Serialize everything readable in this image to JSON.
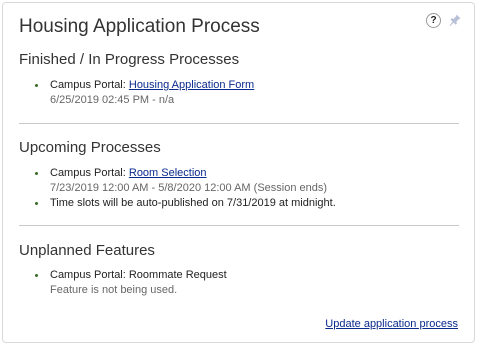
{
  "card": {
    "title": "Housing Application Process",
    "help_label": "?",
    "update_link": "Update application process"
  },
  "finished": {
    "heading": "Finished / In Progress Processes",
    "items": [
      {
        "prefix": "Campus Portal: ",
        "link": "Housing Application Form",
        "detail": "6/25/2019 02:45 PM - n/a"
      }
    ]
  },
  "upcoming": {
    "heading": "Upcoming Processes",
    "items": [
      {
        "prefix": "Campus Portal: ",
        "link": "Room Selection",
        "detail": "7/23/2019 12:00 AM - 5/8/2020 12:00 AM (Session ends)"
      },
      {
        "text": "Time slots will be auto-published on 7/31/2019 at midnight."
      }
    ]
  },
  "unplanned": {
    "heading": "Unplanned Features",
    "items": [
      {
        "text": "Campus Portal: Roommate Request",
        "detail": "Feature is not being used."
      }
    ]
  },
  "colors": {
    "link": "#0a2a8c",
    "bullet": "#3a6b2a",
    "divider": "#c8c8c8"
  },
  "icons": [
    "help-icon",
    "pin-icon"
  ]
}
